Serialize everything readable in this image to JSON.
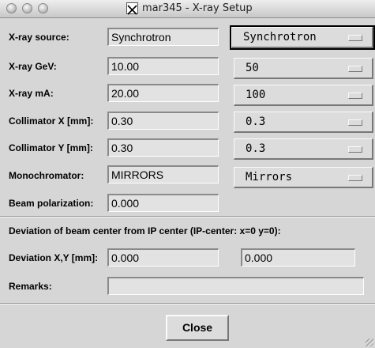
{
  "window": {
    "title": "mar345 - X-ray Setup"
  },
  "form": {
    "xray_source": {
      "label": "X-ray source:",
      "value": "Synchrotron",
      "menu": "Synchrotron"
    },
    "xray_gev": {
      "label": "X-ray  GeV:",
      "value": "10.00",
      "menu": "50"
    },
    "xray_ma": {
      "label": "X-ray  mA:",
      "value": "20.00",
      "menu": "100"
    },
    "collimator_x": {
      "label": "Collimator X [mm]:",
      "value": "0.30",
      "menu": "0.3"
    },
    "collimator_y": {
      "label": "Collimator Y [mm]:",
      "value": "0.30",
      "menu": "0.3"
    },
    "monochromator": {
      "label": "Monochromator:",
      "value": "MIRRORS",
      "menu": "Mirrors"
    },
    "beam_polarization": {
      "label": "Beam polarization:",
      "value": "0.000"
    },
    "deviation_heading": "Deviation of beam center from IP center (IP-center: x=0 y=0):",
    "deviation_xy": {
      "label": "Deviation X,Y [mm]:",
      "x_value": "0.000",
      "y_value": "0.000"
    },
    "remarks": {
      "label": "Remarks:",
      "value": ""
    }
  },
  "buttons": {
    "close_label": "Close"
  },
  "icons": [
    "close-light-icon",
    "minimize-light-icon",
    "zoom-light-icon",
    "x11-icon",
    "resize-grip-icon"
  ]
}
